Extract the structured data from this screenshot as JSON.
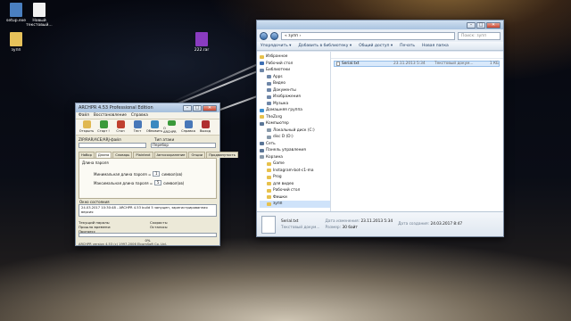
{
  "desktop": {
    "icons": [
      {
        "label": "setup.exe",
        "icon": "app-icon",
        "color": "#4a7fc0"
      },
      {
        "label": "Новый текстовый...",
        "icon": "text-file-icon",
        "color": "#f2f2f2"
      },
      {
        "label": "зупп",
        "icon": "folder-icon",
        "color": "#e6c15a"
      },
      {
        "label": "222.rar",
        "icon": "archive-icon",
        "color": "#8a3cc0"
      }
    ]
  },
  "explorer": {
    "title": "",
    "address": "« зупп ›",
    "search_placeholder": "Поиск: зупп",
    "menu": [
      "Упорядочить ▾",
      "Добавить в библиотеку ▾",
      "Общий доступ ▾",
      "Печать",
      "Новая папка"
    ],
    "nav": [
      {
        "label": "Избранное",
        "sel": false,
        "color": "#e7c14c"
      },
      {
        "label": "Рабочий стол",
        "sel": false,
        "color": "#3d6fb4"
      },
      {
        "label": "Библиотеки",
        "sel": false,
        "color": "#6f87a8"
      },
      {
        "label": "Apps",
        "sel": false,
        "color": "#6f87a8"
      },
      {
        "label": "Видео",
        "sel": false,
        "color": "#6f87a8"
      },
      {
        "label": "Документы",
        "sel": false,
        "color": "#6f87a8"
      },
      {
        "label": "Изображения",
        "sel": false,
        "color": "#6f87a8"
      },
      {
        "label": "Музыка",
        "sel": false,
        "color": "#6f87a8"
      },
      {
        "label": "Домашняя группа",
        "sel": false,
        "color": "#3d8fd0"
      },
      {
        "label": "TheZorg",
        "sel": false,
        "color": "#e7c14c"
      },
      {
        "label": "Компьютер",
        "sel": false,
        "color": "#5a7596"
      },
      {
        "label": "Локальный диск (C:)",
        "sel": false,
        "color": "#8899aa"
      },
      {
        "label": "disc D (D:)",
        "sel": false,
        "color": "#8899aa"
      },
      {
        "label": "Сеть",
        "sel": false,
        "color": "#5a7596"
      },
      {
        "label": "Панель управления",
        "sel": false,
        "color": "#5a7596"
      },
      {
        "label": "Корзина",
        "sel": false,
        "color": "#8899aa"
      },
      {
        "label": "Game",
        "sel": false,
        "color": "#e7c14c"
      },
      {
        "label": "Instagram-bot-c1-ma",
        "sel": false,
        "color": "#e7c14c"
      },
      {
        "label": "Prog",
        "sel": false,
        "color": "#e7c14c"
      },
      {
        "label": "для видео",
        "sel": false,
        "color": "#e7c14c"
      },
      {
        "label": "Рабочий стол",
        "sel": false,
        "color": "#e7c14c"
      },
      {
        "label": "Фишки",
        "sel": false,
        "color": "#e7c14c"
      },
      {
        "label": "зупп",
        "sel": true,
        "color": "#e7c14c"
      }
    ],
    "file": {
      "name": "Serial.txt",
      "date": "23.11.2013 5:34",
      "type": "Текстовый докум...",
      "size": "1 КБ"
    },
    "details": {
      "name": "Serial.txt",
      "type": "Текстовый докум...",
      "modified_label": "Дата изменения:",
      "modified": "23.11.2013 5:34",
      "created_label": "Дата создания:",
      "created": "24.03.2017 8:47",
      "size_label": "Размер:",
      "size": "30 байт"
    }
  },
  "archiver": {
    "title": "ARCHPR 4.53 Professional Edition",
    "menu": [
      "Файл",
      "Восстановление",
      "Справка"
    ],
    "tools": [
      {
        "label": "Открыть",
        "color": "#e0b850"
      },
      {
        "label": "Старт !",
        "color": "#3a9a3a"
      },
      {
        "label": "Стоп",
        "color": "#c04030"
      },
      {
        "label": "Тест",
        "color": "#4878b8"
      },
      {
        "label": "Обновить",
        "color": "#3a8ac0"
      },
      {
        "label": "О ARCHPR",
        "color": "#3a9a3a"
      },
      {
        "label": "Справка",
        "color": "#4878b8"
      },
      {
        "label": "Выход",
        "color": "#b03030"
      }
    ],
    "file_label": "ZIP/RAR/ACE/ARJ-файл",
    "attack_label": "Тип атаки",
    "attack_value": "Перебор",
    "tabs": [
      "Набор",
      "Длина",
      "Словарь",
      "Plaintext",
      "Автосохранение",
      "Опции",
      "Продвинутость"
    ],
    "panel_title": "Длина пароля",
    "min_label": "Минимальная длина пароля =",
    "min_value": "1",
    "min_unit": "символ(ов)",
    "max_label": "Максимальная длина пароля =",
    "max_value": "5",
    "max_unit": "символ(ов)",
    "log_title": "Окно состояния",
    "log": "24.03.2017 10:30:48 - ARCHPR 4.53 build 5 запущен, зарегистрированная версия",
    "stats": [
      {
        "label": "Текущий пароль:",
        "right_label": "Скорость:"
      },
      {
        "label": "Прошло времени:",
        "right_label": "Осталось:"
      },
      {
        "label": "Прогресс",
        "right_label": ""
      }
    ],
    "progress_pct": 0,
    "progress_text": "0%",
    "footer": "ARCHPR version 4.53 (c) 1997-2006 ElcomSoft Co. Ltd."
  }
}
